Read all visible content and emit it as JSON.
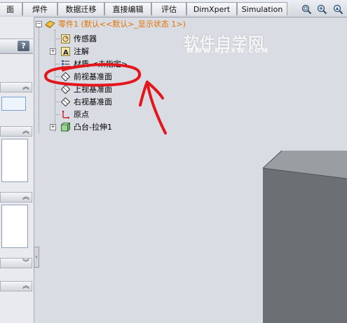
{
  "tabs": [
    "面",
    "焊件",
    "数据迁移",
    "直接编辑",
    "评估",
    "DimXpert",
    "Simulation"
  ],
  "toolbar_icons": [
    "zoom-to-fit-icon",
    "zoom-to-area-icon",
    "view-settings-icon"
  ],
  "left_pane": {
    "help_label": "?"
  },
  "tree": {
    "root": "零件1  (默认<<默认>_显示状态 1>)",
    "items": [
      {
        "label": "传感器",
        "icon": "sensor-icon",
        "expandable": false
      },
      {
        "label": "注解",
        "icon": "annotation-icon",
        "expandable": true
      },
      {
        "label": "材质 <未指定>",
        "icon": "material-icon",
        "expandable": false
      },
      {
        "label": "前视基准面",
        "icon": "plane-icon",
        "expandable": false
      },
      {
        "label": "上视基准面",
        "icon": "plane-icon",
        "expandable": false
      },
      {
        "label": "右视基准面",
        "icon": "plane-icon",
        "expandable": false
      },
      {
        "label": "原点",
        "icon": "origin-icon",
        "expandable": false
      },
      {
        "label": "凸台-拉伸1",
        "icon": "boss-extrude-icon",
        "expandable": true
      }
    ]
  },
  "watermark": {
    "text": "软件自学网",
    "url": "WWW.RJZXW.COM"
  },
  "colors": {
    "root_text": "#e07000",
    "annotation_red": "#e3161c",
    "model_face": "#6c6f74",
    "model_top": "#9a9da2",
    "viewport_bg": "#d9dce2"
  }
}
